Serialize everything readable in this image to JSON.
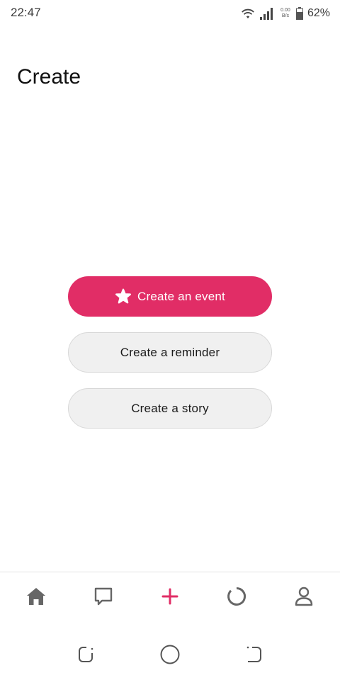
{
  "status_bar": {
    "time": "22:47",
    "net_speed_value": "0.00",
    "net_speed_unit": "B/s",
    "battery_percent": "62%",
    "icons": [
      "wifi-icon",
      "signal-icon",
      "battery-icon"
    ]
  },
  "page": {
    "title": "Create"
  },
  "actions": {
    "create_event": "Create an event",
    "create_reminder": "Create a reminder",
    "create_story": "Create a story",
    "event_icon": "star-icon"
  },
  "bottom_nav": {
    "items": [
      {
        "icon": "home-icon"
      },
      {
        "icon": "chat-icon"
      },
      {
        "icon": "plus-icon"
      },
      {
        "icon": "circle-progress-icon"
      },
      {
        "icon": "profile-icon"
      }
    ]
  },
  "system_nav": {
    "items": [
      "recents-icon",
      "home-circle-icon",
      "back-icon"
    ]
  },
  "colors": {
    "accent": "#e12d66",
    "secondary_button_bg": "#f0f0f0",
    "nav_icon": "#666666"
  }
}
